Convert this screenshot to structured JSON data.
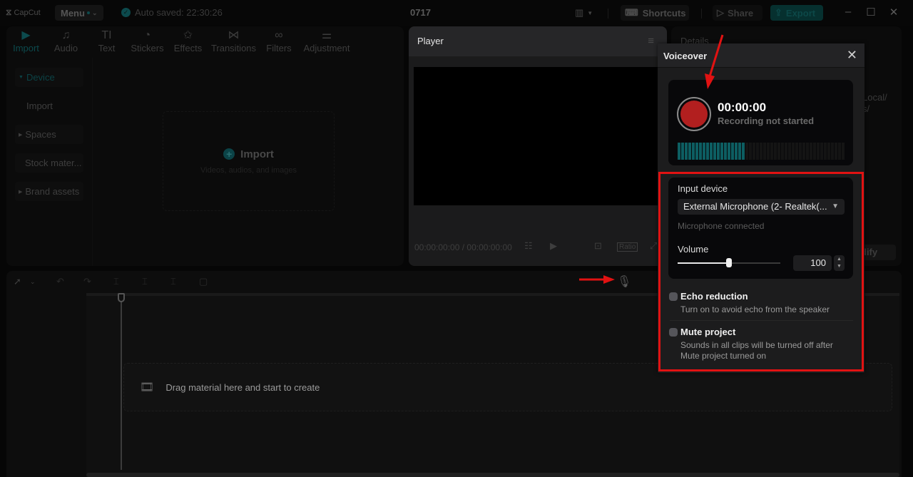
{
  "titlebar": {
    "app_name": "CapCut",
    "menu_label": "Menu",
    "autosave_text": "Auto saved: 22:30:26",
    "project_name": "0717",
    "shortcuts_label": "Shortcuts",
    "share_label": "Share",
    "export_label": "Export"
  },
  "media_panel": {
    "tabs": [
      {
        "label": "Import",
        "icon": "▶"
      },
      {
        "label": "Audio",
        "icon": "♫"
      },
      {
        "label": "Text",
        "icon": "TI"
      },
      {
        "label": "Stickers",
        "icon": "◔"
      },
      {
        "label": "Effects",
        "icon": "✩"
      },
      {
        "label": "Transitions",
        "icon": "⋈"
      },
      {
        "label": "Filters",
        "icon": "∞"
      },
      {
        "label": "Adjustment",
        "icon": "⚌"
      }
    ],
    "sidebar": [
      {
        "label": "Device"
      },
      {
        "label": "Import"
      },
      {
        "label": "Spaces"
      },
      {
        "label": "Stock mater..."
      },
      {
        "label": "Brand assets"
      }
    ],
    "import_title": "Import",
    "import_subtitle": "Videos, audios, and images"
  },
  "player": {
    "title": "Player",
    "timecode": "00:00:00:00 / 00:00:00:00",
    "ratio_label": "Ratio"
  },
  "details": {
    "title": "Details",
    "path_fragment_1": "Local/",
    "path_fragment_2": "s/",
    "modify_label": "dify"
  },
  "timeline": {
    "drop_text": "Drag material here and start to create"
  },
  "voiceover": {
    "title": "Voiceover",
    "time": "00:00:00",
    "status": "Recording not started",
    "meter_level_fraction": 0.4,
    "input_device_label": "Input device",
    "input_device_value": "External Microphone (2- Realtek(...",
    "mic_status": "Microphone connected",
    "volume_label": "Volume",
    "volume_value": "100",
    "volume_fraction": 0.5,
    "echo_title": "Echo reduction",
    "echo_desc": "Turn on to avoid echo from the speaker",
    "echo_on": false,
    "mute_title": "Mute project",
    "mute_desc": "Sounds in all clips will be turned off after Mute project turned on",
    "mute_on": false
  },
  "colors": {
    "accent": "#0c4a4d",
    "record": "#b21f1f",
    "annotation": "#e11212"
  }
}
